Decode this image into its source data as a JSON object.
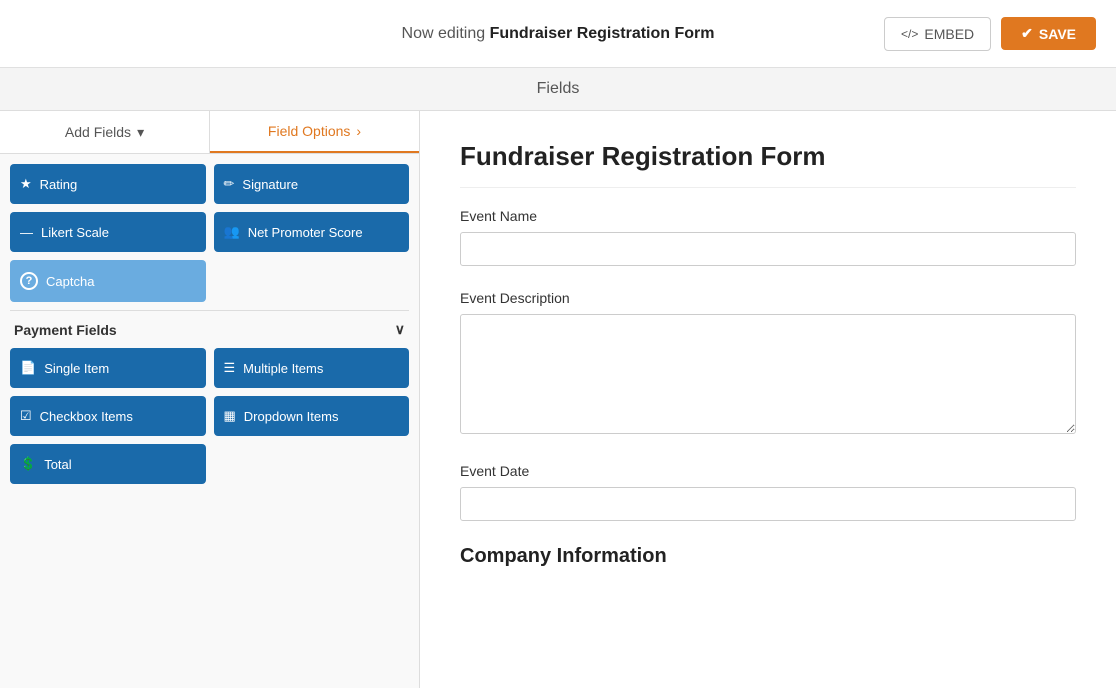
{
  "topbar": {
    "editing_label": "Now editing ",
    "form_name": "Fundraiser Registration Form",
    "embed_label": "EMBED",
    "save_label": "SAVE",
    "embed_icon": "</>"
  },
  "fields_header": {
    "label": "Fields"
  },
  "left_panel": {
    "tab_add_fields": "Add Fields",
    "tab_add_fields_icon": "▾",
    "tab_field_options": "Field Options",
    "tab_field_options_icon": "›",
    "field_buttons": [
      {
        "label": "Rating",
        "icon": "★",
        "light": false
      },
      {
        "label": "Signature",
        "icon": "✏",
        "light": false
      },
      {
        "label": "Likert Scale",
        "icon": "—",
        "light": false
      },
      {
        "label": "Net Promoter Score",
        "icon": "👥",
        "light": false
      },
      {
        "label": "Captcha",
        "icon": "?",
        "light": true
      }
    ],
    "payment_section": "Payment Fields",
    "payment_fields": [
      {
        "label": "Single Item",
        "icon": "📄",
        "light": false
      },
      {
        "label": "Multiple Items",
        "icon": "☰",
        "light": false
      },
      {
        "label": "Checkbox Items",
        "icon": "☑",
        "light": false
      },
      {
        "label": "Dropdown Items",
        "icon": "▦",
        "light": false
      },
      {
        "label": "Total",
        "icon": "💲",
        "light": false
      }
    ]
  },
  "form": {
    "title": "Fundraiser Registration Form",
    "fields": [
      {
        "label": "Event Name",
        "type": "input",
        "placeholder": ""
      },
      {
        "label": "Event Description",
        "type": "textarea",
        "placeholder": ""
      },
      {
        "label": "Event Date",
        "type": "input",
        "placeholder": ""
      }
    ],
    "section": "Company Information"
  }
}
